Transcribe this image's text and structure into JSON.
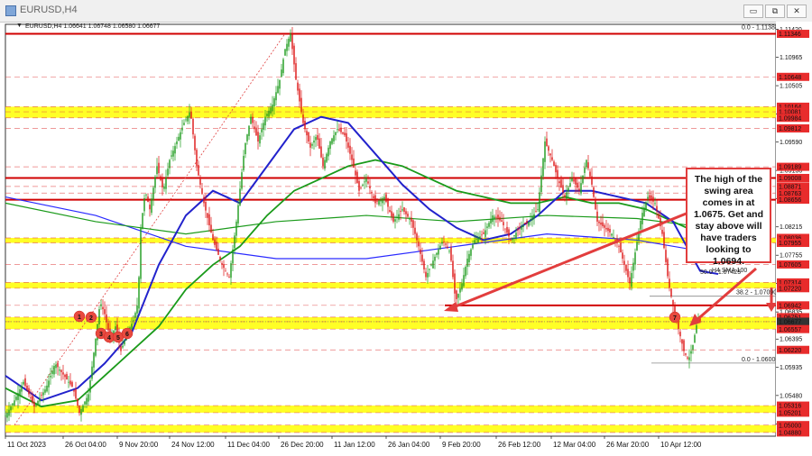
{
  "window": {
    "title": "EURUSD,H4",
    "buttons": {
      "minimize": "▭",
      "restore": "⧉",
      "close": "✕"
    }
  },
  "chart_data": {
    "type": "candlestick",
    "symbol_info": "EURUSD,H4  1.06641 1.06748 1.06580 1.06677",
    "y_ticks": [
      "1.11420",
      "1.10965",
      "1.10505",
      "1.10045",
      "1.09590",
      "1.09130",
      "1.08670",
      "1.08215",
      "1.07755",
      "1.07295",
      "1.06835",
      "1.06395",
      "1.05935",
      "1.05480",
      "1.05020"
    ],
    "x_ticks": [
      "11 Oct 2023",
      "26 Oct 04:00",
      "9 Nov 20:00",
      "24 Nov 12:00",
      "11 Dec 04:00",
      "26 Dec 20:00",
      "11 Jan 12:00",
      "26 Jan 04:00",
      "9 Feb 20:00",
      "26 Feb 12:00",
      "12 Mar 04:00",
      "26 Mar 20:00",
      "10 Apr 12:00"
    ],
    "ylim": [
      1.0482,
      1.115
    ],
    "price_tags": [
      "1.11346",
      "1.10648",
      "1.10164",
      "1.10081",
      "1.09984",
      "1.09812",
      "1.09189",
      "1.09008",
      "1.08871",
      "1.08763",
      "1.08656",
      "1.08036",
      "1.07955",
      "1.07605",
      "1.07314",
      "1.07220",
      "1.06942",
      "1.06751",
      "1.06677",
      "1.06557",
      "1.06220",
      "1.05316",
      "1.05201",
      "1.05000",
      "1.04880"
    ],
    "fib_annotations": [
      "0.0 - 1.11388",
      "50.0 - 1.07425",
      "38.2 - 1.07090",
      "0.0 - 1.06006"
    ],
    "ma_label": "H4 SMA 100",
    "red_levels": [
      1.11346,
      1.09008,
      1.08656
    ],
    "yellow_zones": [
      [
        1.10164,
        1.09984
      ],
      [
        1.08036,
        1.07955
      ],
      [
        1.07314,
        1.0722
      ],
      [
        1.06751,
        1.06557
      ],
      [
        1.05316,
        1.05201
      ],
      [
        1.05,
        1.0488
      ]
    ],
    "swing_high_level": 1.06942,
    "markers": [
      "1",
      "2",
      "3",
      "4",
      "5",
      "6",
      "7"
    ],
    "price_path": [
      [
        0,
        1.0515
      ],
      [
        10,
        1.054
      ],
      [
        20,
        1.057
      ],
      [
        32,
        1.053
      ],
      [
        45,
        1.056
      ],
      [
        55,
        1.06
      ],
      [
        65,
        1.058
      ],
      [
        75,
        1.056
      ],
      [
        82,
        1.052
      ],
      [
        92,
        1.055
      ],
      [
        100,
        1.064
      ],
      [
        105,
        1.07
      ],
      [
        110,
        1.068
      ],
      [
        116,
        1.064
      ],
      [
        122,
        1.066
      ],
      [
        128,
        1.062
      ],
      [
        135,
        1.065
      ],
      [
        142,
        1.067
      ],
      [
        147,
        1.07
      ],
      [
        150,
        1.082
      ],
      [
        155,
        1.088
      ],
      [
        160,
        1.085
      ],
      [
        168,
        1.092
      ],
      [
        175,
        1.088
      ],
      [
        182,
        1.093
      ],
      [
        190,
        1.096
      ],
      [
        198,
        1.099
      ],
      [
        205,
        1.101
      ],
      [
        212,
        1.092
      ],
      [
        220,
        1.086
      ],
      [
        230,
        1.08
      ],
      [
        240,
        1.076
      ],
      [
        248,
        1.074
      ],
      [
        256,
        1.083
      ],
      [
        265,
        1.095
      ],
      [
        272,
        1.1
      ],
      [
        280,
        1.096
      ],
      [
        288,
        1.1
      ],
      [
        296,
        1.102
      ],
      [
        304,
        1.106
      ],
      [
        310,
        1.111
      ],
      [
        316,
        1.1135
      ],
      [
        322,
        1.106
      ],
      [
        330,
        1.099
      ],
      [
        338,
        1.095
      ],
      [
        345,
        1.097
      ],
      [
        352,
        1.092
      ],
      [
        360,
        1.096
      ],
      [
        368,
        1.098
      ],
      [
        376,
        1.097
      ],
      [
        384,
        1.093
      ],
      [
        392,
        1.088
      ],
      [
        400,
        1.09
      ],
      [
        410,
        1.086
      ],
      [
        420,
        1.087
      ],
      [
        430,
        1.083
      ],
      [
        440,
        1.085
      ],
      [
        450,
        1.083
      ],
      [
        458,
        1.079
      ],
      [
        466,
        1.074
      ],
      [
        475,
        1.077
      ],
      [
        485,
        1.08
      ],
      [
        493,
        1.078
      ],
      [
        499,
        1.07
      ],
      [
        506,
        1.073
      ],
      [
        512,
        1.077
      ],
      [
        520,
        1.08
      ],
      [
        530,
        1.081
      ],
      [
        540,
        1.084
      ],
      [
        550,
        1.083
      ],
      [
        560,
        1.08
      ],
      [
        570,
        1.082
      ],
      [
        580,
        1.083
      ],
      [
        590,
        1.085
      ],
      [
        598,
        1.096
      ],
      [
        606,
        1.093
      ],
      [
        612,
        1.09
      ],
      [
        620,
        1.087
      ],
      [
        628,
        1.09
      ],
      [
        636,
        1.088
      ],
      [
        644,
        1.093
      ],
      [
        650,
        1.089
      ],
      [
        656,
        1.083
      ],
      [
        664,
        1.082
      ],
      [
        672,
        1.081
      ],
      [
        680,
        1.079
      ],
      [
        686,
        1.076
      ],
      [
        692,
        1.073
      ],
      [
        698,
        1.078
      ],
      [
        705,
        1.084
      ],
      [
        712,
        1.087
      ],
      [
        720,
        1.086
      ],
      [
        728,
        1.081
      ],
      [
        735,
        1.073
      ],
      [
        742,
        1.068
      ],
      [
        747,
        1.065
      ],
      [
        752,
        1.062
      ],
      [
        757,
        1.0605
      ],
      [
        762,
        1.063
      ],
      [
        767,
        1.067
      ],
      [
        770,
        1.0668
      ]
    ],
    "blue_ma": [
      [
        0,
        1.058
      ],
      [
        40,
        1.054
      ],
      [
        80,
        1.056
      ],
      [
        110,
        1.06
      ],
      [
        140,
        1.065
      ],
      [
        170,
        1.076
      ],
      [
        200,
        1.084
      ],
      [
        230,
        1.088
      ],
      [
        260,
        1.086
      ],
      [
        290,
        1.092
      ],
      [
        320,
        1.098
      ],
      [
        350,
        1.1
      ],
      [
        380,
        1.099
      ],
      [
        410,
        1.094
      ],
      [
        440,
        1.089
      ],
      [
        470,
        1.085
      ],
      [
        500,
        1.082
      ],
      [
        530,
        1.08
      ],
      [
        560,
        1.081
      ],
      [
        590,
        1.084
      ],
      [
        620,
        1.088
      ],
      [
        650,
        1.088
      ],
      [
        680,
        1.087
      ],
      [
        710,
        1.086
      ],
      [
        740,
        1.083
      ],
      [
        770,
        1.075
      ],
      [
        790,
        1.0745
      ]
    ],
    "green_ma": [
      [
        0,
        1.056
      ],
      [
        40,
        1.053
      ],
      [
        80,
        1.054
      ],
      [
        110,
        1.058
      ],
      [
        140,
        1.062
      ],
      [
        170,
        1.066
      ],
      [
        200,
        1.072
      ],
      [
        230,
        1.076
      ],
      [
        260,
        1.079
      ],
      [
        290,
        1.084
      ],
      [
        320,
        1.088
      ],
      [
        350,
        1.09
      ],
      [
        380,
        1.092
      ],
      [
        410,
        1.093
      ],
      [
        440,
        1.092
      ],
      [
        470,
        1.09
      ],
      [
        500,
        1.088
      ],
      [
        530,
        1.087
      ],
      [
        560,
        1.086
      ],
      [
        590,
        1.086
      ],
      [
        620,
        1.087
      ],
      [
        650,
        1.086
      ],
      [
        680,
        1.086
      ],
      [
        710,
        1.085
      ],
      [
        740,
        1.083
      ],
      [
        770,
        1.081
      ]
    ],
    "green200": [
      [
        0,
        1.086
      ],
      [
        100,
        1.083
      ],
      [
        200,
        1.081
      ],
      [
        300,
        1.083
      ],
      [
        400,
        1.084
      ],
      [
        500,
        1.083
      ],
      [
        600,
        1.084
      ],
      [
        700,
        1.0835
      ],
      [
        780,
        1.082
      ]
    ],
    "blue200": [
      [
        0,
        1.087
      ],
      [
        100,
        1.084
      ],
      [
        200,
        1.079
      ],
      [
        300,
        1.077
      ],
      [
        400,
        1.077
      ],
      [
        500,
        1.079
      ],
      [
        600,
        1.081
      ],
      [
        700,
        1.08
      ],
      [
        780,
        1.078
      ]
    ]
  },
  "callout": {
    "text": "The high of the swing area comes in at 1.0675. Get and stay above will have traders looking to 1.0694."
  }
}
